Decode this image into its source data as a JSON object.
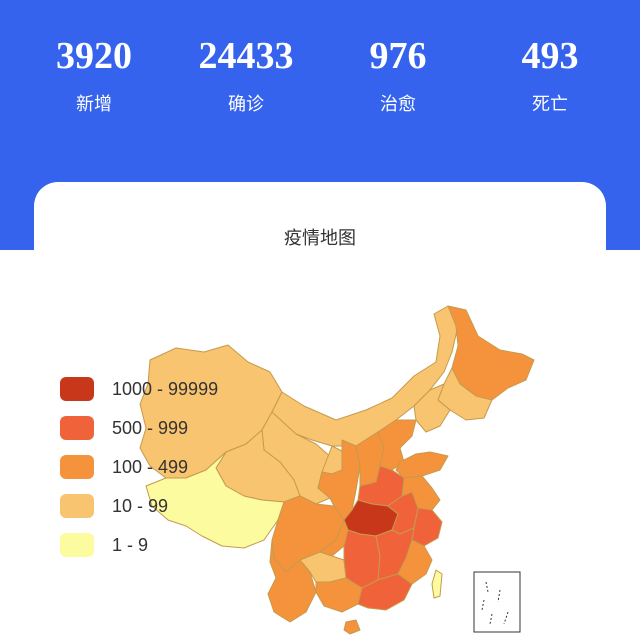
{
  "stats": [
    {
      "value": "3920",
      "label": "新增"
    },
    {
      "value": "24433",
      "label": "确诊"
    },
    {
      "value": "976",
      "label": "治愈"
    },
    {
      "value": "493",
      "label": "死亡"
    }
  ],
  "map": {
    "title": "疫情地图",
    "legend": [
      {
        "label": "1000 - 99999",
        "color": "#c9371a"
      },
      {
        "label": "500 - 999",
        "color": "#f0633a"
      },
      {
        "label": "100 - 499",
        "color": "#f5933d"
      },
      {
        "label": "10 - 99",
        "color": "#f8c46f"
      },
      {
        "label": "1 - 9",
        "color": "#fdfb9f"
      }
    ]
  },
  "colors": {
    "header": "#3563ee",
    "border": "#c59a4c"
  }
}
